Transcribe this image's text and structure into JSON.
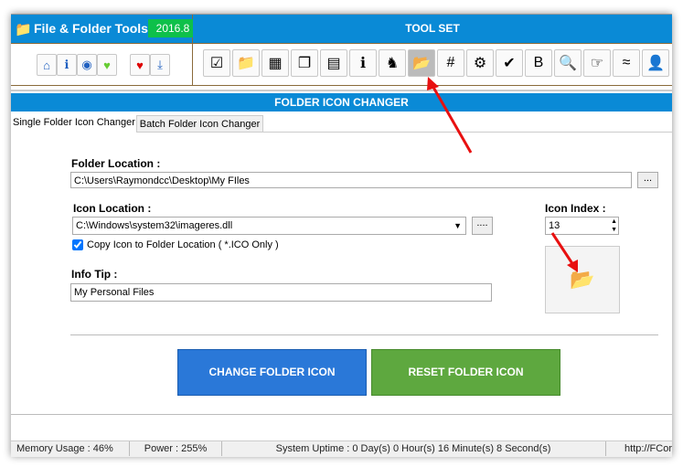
{
  "app": {
    "title": "File & Folder Tools",
    "version": "2016.8",
    "toolset_label": "TOOL SET",
    "accent": "#0a8ad6"
  },
  "left_icons": [
    "home-icon",
    "info-icon",
    "broadcast-icon",
    "health-heart-icon",
    "favorite-heart-icon",
    "download-icon"
  ],
  "tool_icons": [
    "checklist-icon",
    "folder-add-icon",
    "calendar-icon",
    "copy-files-icon",
    "file-shred-icon",
    "info-icon",
    "dark-knight-icon",
    "folder-icon",
    "hash-icon",
    "gear-red-icon",
    "shield-check-icon",
    "text-convert-icon",
    "search-icon",
    "hand-pointer-icon",
    "file-diff-icon",
    "user-lock-icon"
  ],
  "section_title": "FOLDER ICON CHANGER",
  "tabs": [
    {
      "label": "Single Folder Icon Changer",
      "active": true
    },
    {
      "label": "Batch Folder Icon Changer",
      "active": false
    }
  ],
  "form": {
    "folder_location_label": "Folder Location :",
    "folder_location_value": "C:\\Users\\Raymondcc\\Desktop\\My FIles",
    "browse1": "...",
    "icon_location_label": "Icon Location :",
    "icon_location_value": "C:\\Windows\\system32\\imageres.dll",
    "browse2": "....",
    "copy_icon_label": "Copy Icon to Folder Location ( *.ICO Only )",
    "copy_icon_checked": true,
    "info_tip_label": "Info Tip :",
    "info_tip_value": "My Personal Files",
    "icon_index_label": "Icon Index :",
    "icon_index_value": "13"
  },
  "buttons": {
    "change": "CHANGE FOLDER ICON",
    "reset": "RESET FOLDER ICON"
  },
  "status": {
    "memory": "Memory Usage : 46%",
    "power": "Power : 255%",
    "uptime": "System Uptime : 0 Day(s) 0 Hour(s) 16 Minute(s) 8 Second(s)",
    "url": "http://FCor"
  }
}
